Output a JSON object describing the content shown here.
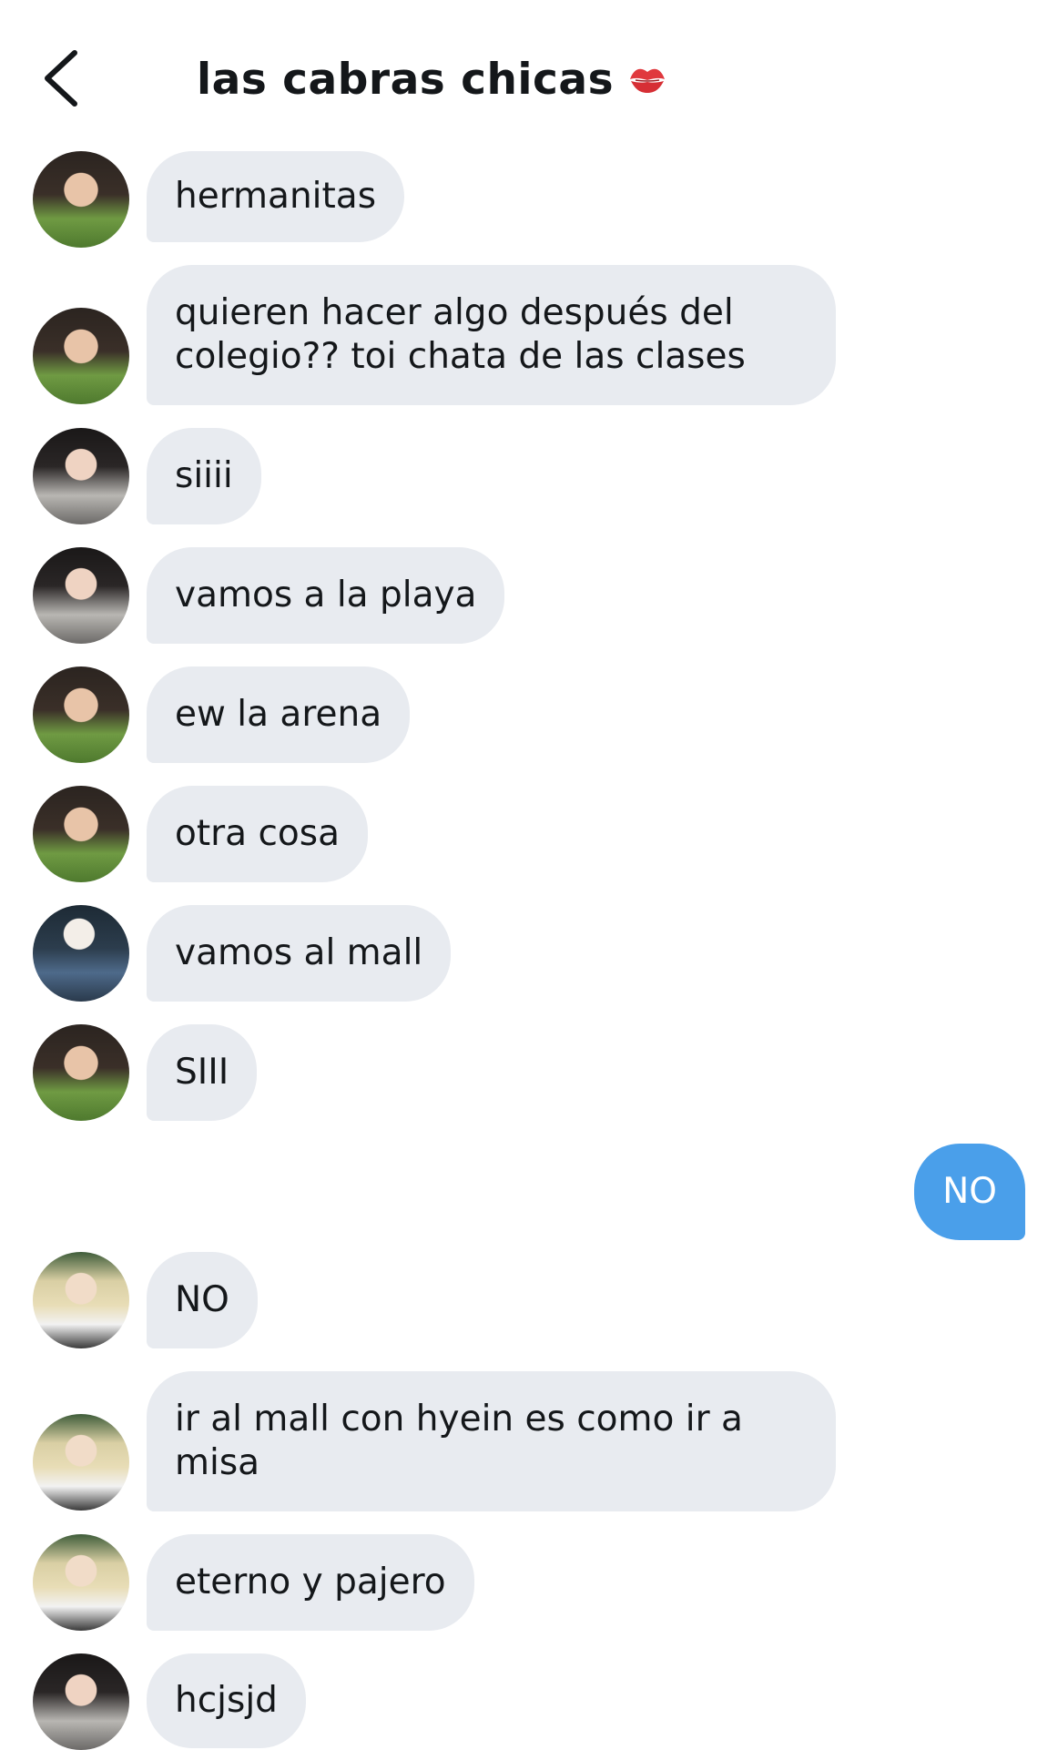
{
  "header": {
    "back_icon": "chevron-left-icon",
    "title": "las cabras chicas",
    "title_emoji_icon": "kiss-mark-icon"
  },
  "colors": {
    "incoming_bubble": "#e8ebf0",
    "outgoing_bubble": "#4a9fea",
    "text": "#14171a"
  },
  "messages": [
    {
      "sender": "a",
      "text": "hermanitas"
    },
    {
      "sender": "a",
      "text": "quieren hacer algo después del colegio?? toi chata de las clases"
    },
    {
      "sender": "b",
      "text": "siiii"
    },
    {
      "sender": "b",
      "text": "vamos a la playa"
    },
    {
      "sender": "a",
      "text": "ew la arena"
    },
    {
      "sender": "a",
      "text": "otra cosa"
    },
    {
      "sender": "c",
      "text": "vamos al mall"
    },
    {
      "sender": "a",
      "text": "SIII"
    },
    {
      "sender": "me",
      "text": "NO"
    },
    {
      "sender": "d",
      "text": "NO"
    },
    {
      "sender": "d",
      "text": "ir al mall con hyein es como ir a misa"
    },
    {
      "sender": "d",
      "text": "eterno y pajero"
    },
    {
      "sender": "b",
      "text": "hcjsjd"
    }
  ]
}
